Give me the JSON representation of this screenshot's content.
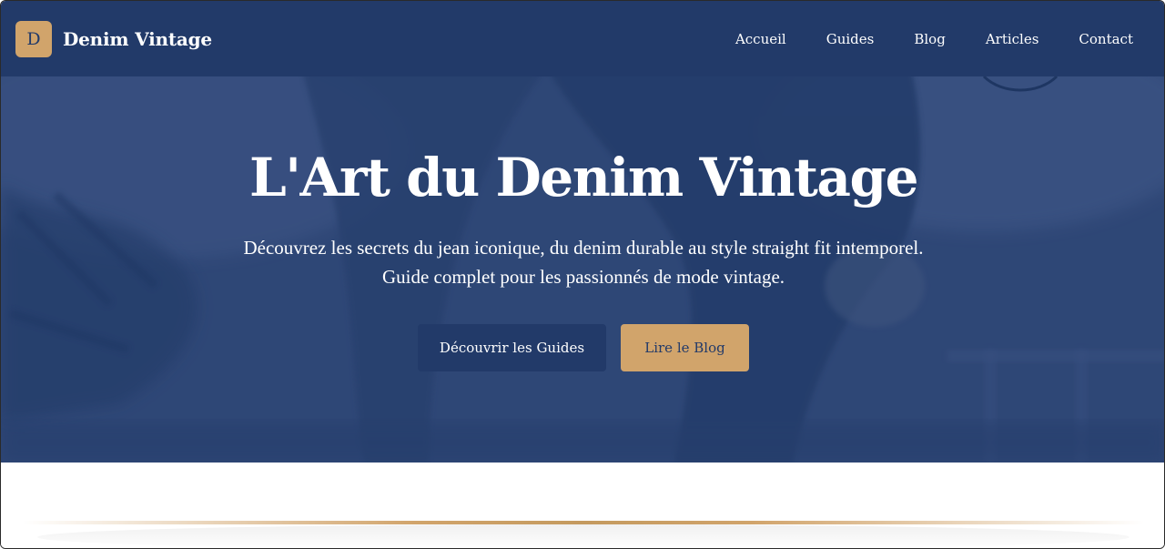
{
  "header": {
    "logo_letter": "D",
    "brand_name": "Denim Vintage",
    "nav": [
      {
        "label": "Accueil"
      },
      {
        "label": "Guides"
      },
      {
        "label": "Blog"
      },
      {
        "label": "Articles"
      },
      {
        "label": "Contact"
      }
    ]
  },
  "hero": {
    "title": "L'Art du Denim Vintage",
    "subtitle": "Découvrez les secrets du jean iconique, du denim durable au style straight fit intemporel. Guide complet pour les passionnés de mode vintage.",
    "primary_button": "Découvrir les Guides",
    "secondary_button": "Lire le Blog",
    "background_image": "denim-photo"
  },
  "colors": {
    "navy": "#223a69",
    "gold": "#d1a46b",
    "white": "#ffffff"
  }
}
